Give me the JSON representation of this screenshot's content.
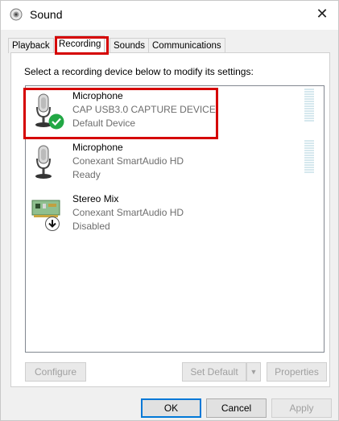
{
  "window": {
    "title": "Sound",
    "close_symbol": "✕"
  },
  "tabs": [
    {
      "label": "Playback"
    },
    {
      "label": "Recording"
    },
    {
      "label": "Sounds"
    },
    {
      "label": "Communications"
    }
  ],
  "active_tab": "Recording",
  "instructions": "Select a recording device below to modify its settings:",
  "devices": [
    {
      "name": "Microphone",
      "description": "CAP USB3.0 CAPTURE DEVICE",
      "status": "Default Device",
      "icon": "microphone-icon",
      "badge": "green-check-badge-icon",
      "has_level_meter": true
    },
    {
      "name": "Microphone",
      "description": "Conexant SmartAudio HD",
      "status": "Ready",
      "icon": "microphone-icon",
      "has_level_meter": true
    },
    {
      "name": "Stereo Mix",
      "description": "Conexant SmartAudio HD",
      "status": "Disabled",
      "icon": "sound-card-icon",
      "badge": "disabled-arrow-badge-icon",
      "has_level_meter": false
    }
  ],
  "buttons": {
    "configure": "Configure",
    "set_default": "Set Default",
    "properties": "Properties",
    "ok": "OK",
    "cancel": "Cancel",
    "apply": "Apply"
  },
  "colors": {
    "highlight": "#d50000",
    "accent": "#0078d7",
    "check_green": "#22a845"
  }
}
